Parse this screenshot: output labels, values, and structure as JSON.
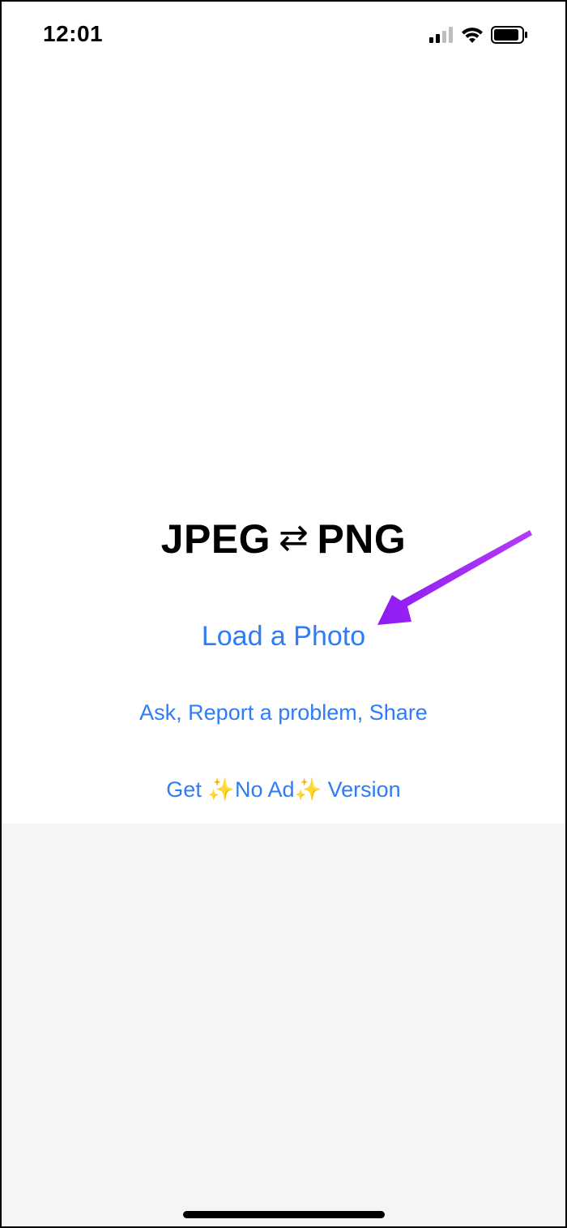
{
  "status_bar": {
    "time": "12:01",
    "icons": [
      "cellular-signal-icon",
      "wifi-icon",
      "battery-icon"
    ]
  },
  "main": {
    "title_left": "JPEG",
    "title_arrows": "⇄",
    "title_right": "PNG",
    "load_photo_label": "Load a Photo",
    "ask_label": "Ask, Report a problem, Share",
    "noad": {
      "prefix": "Get ",
      "sparkle1": "✨",
      "middle": "No Ad",
      "sparkle2": "✨",
      "suffix": " Version"
    }
  },
  "colors": {
    "link": "#2e7cf6",
    "annotation_arrow": "#a020f0",
    "ad_area": "#f5f5f5"
  }
}
